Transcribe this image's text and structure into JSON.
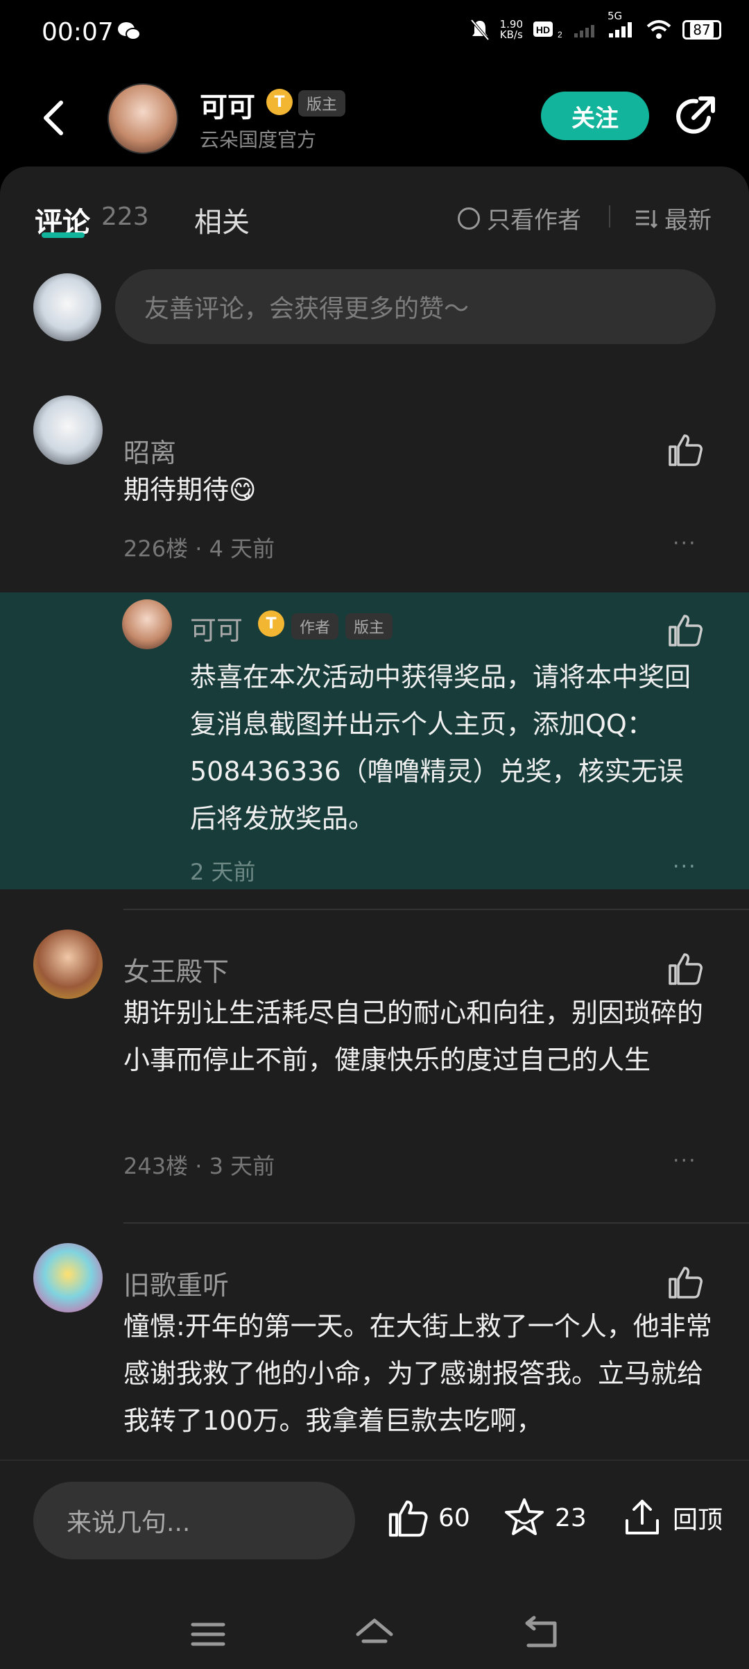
{
  "status_bar": {
    "time": "00:07",
    "net_speed_value": "1.90",
    "net_speed_unit": "KB/s",
    "battery": "87",
    "signal": "5G"
  },
  "header": {
    "user_name": "可可",
    "badge_letter": "T",
    "role": "版主",
    "subtitle": "云朵国度官方",
    "follow_label": "关注"
  },
  "tabs": {
    "comments_label": "评论",
    "comments_count": "223",
    "related_label": "相关",
    "author_only_label": "只看作者",
    "sort_label": "最新"
  },
  "comment_input": {
    "placeholder": "友善评论，会获得更多的赞～"
  },
  "comments": [
    {
      "name": "昭离",
      "text": "期待期待",
      "emoji": "😋",
      "floor": "226楼",
      "time": "4 天前"
    },
    {
      "name": "女王殿下",
      "text": "期许别让生活耗尽自己的耐心和向往，别因琐碎的小事而停止不前，健康快乐的度过自己的人生",
      "floor": "243楼",
      "time": "3 天前"
    },
    {
      "name": "旧歌重听",
      "text": "憧憬:开年的第一天。在大街上救了一个人，他非常感谢我救了他的小命，为了感谢报答我。立马就给我转了100万。我拿着巨款去吃啊，"
    }
  ],
  "reply": {
    "name": "可可",
    "badge_letter": "T",
    "role_author": "作者",
    "role_mod": "版主",
    "text": "恭喜在本次活动中获得奖品，请将本中奖回复消息截图并出示个人主页，添加QQ：508436336（噜噜精灵）兑奖，核实无误后将发放奖品。",
    "time": "2 天前"
  },
  "separator": "·",
  "more": "···",
  "bottom_bar": {
    "input_placeholder": "来说几句...",
    "like_count": "60",
    "star_count": "23",
    "top_label": "回顶"
  },
  "colors": {
    "accent": "#12b59b",
    "reply_bg": "#173c39",
    "background": "#1e1e1e"
  }
}
